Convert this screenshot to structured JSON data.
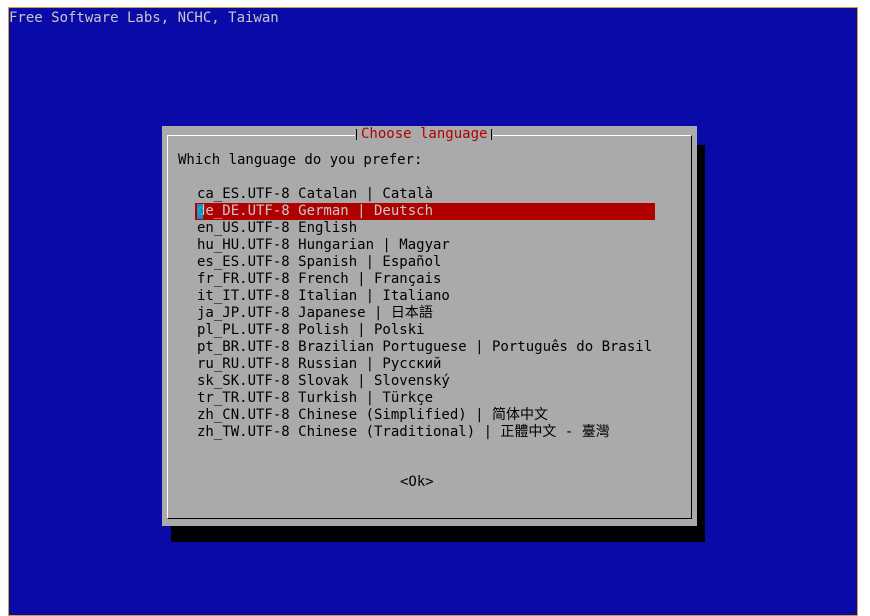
{
  "backtitle": "Free Software Labs, NCHC, Taiwan",
  "dialog": {
    "title": "Choose language",
    "prompt": "Which language do you prefer:",
    "ok_label": "<Ok>"
  },
  "languages": [
    {
      "label": "ca_ES.UTF-8 Catalan | Català",
      "selected": false
    },
    {
      "label": "de_DE.UTF-8 German | Deutsch",
      "selected": true
    },
    {
      "label": "en_US.UTF-8 English",
      "selected": false
    },
    {
      "label": "hu_HU.UTF-8 Hungarian | Magyar",
      "selected": false
    },
    {
      "label": "es_ES.UTF-8 Spanish | Español",
      "selected": false
    },
    {
      "label": "fr_FR.UTF-8 French | Français",
      "selected": false
    },
    {
      "label": "it_IT.UTF-8 Italian | Italiano",
      "selected": false
    },
    {
      "label": "ja_JP.UTF-8 Japanese | 日本語",
      "selected": false
    },
    {
      "label": "pl_PL.UTF-8 Polish | Polski",
      "selected": false
    },
    {
      "label": "pt_BR.UTF-8 Brazilian Portuguese | Português do Brasil",
      "selected": false
    },
    {
      "label": "ru_RU.UTF-8 Russian | Русский",
      "selected": false
    },
    {
      "label": "sk_SK.UTF-8 Slovak | Slovenský",
      "selected": false
    },
    {
      "label": "tr_TR.UTF-8 Turkish | Türkçe",
      "selected": false
    },
    {
      "label": "zh_CN.UTF-8 Chinese (Simplified) | 简体中文",
      "selected": false
    },
    {
      "label": "zh_TW.UTF-8 Chinese (Traditional) | 正體中文 - 臺灣",
      "selected": false
    }
  ],
  "colors": {
    "screen_bg": "#0a0aa8",
    "dialog_bg": "#aaaaaa",
    "selection_bg": "#b00000",
    "title_color": "#b00000"
  }
}
